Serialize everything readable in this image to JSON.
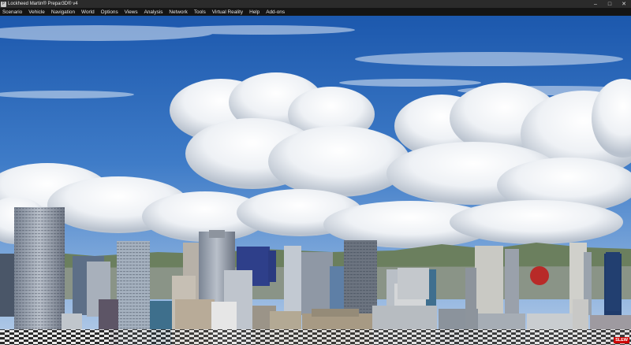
{
  "window": {
    "title": "Lockheed Martin® Prepar3D® v4",
    "app_icon": "p3d-app-icon",
    "controls": {
      "minimize": "–",
      "maximize": "□",
      "close": "✕"
    }
  },
  "menu": {
    "items": [
      {
        "label": "Scenario"
      },
      {
        "label": "Vehicle"
      },
      {
        "label": "Navigation"
      },
      {
        "label": "World"
      },
      {
        "label": "Options"
      },
      {
        "label": "Views"
      },
      {
        "label": "Analysis"
      },
      {
        "label": "Network"
      },
      {
        "label": "Tools"
      },
      {
        "label": "Virtual Reality"
      },
      {
        "label": "Help"
      },
      {
        "label": "Add-ons"
      }
    ]
  },
  "status": {
    "slew_label": "SLEW"
  },
  "colors": {
    "sky_top": "#1f5fb3",
    "sky_horizon": "#a9c6e6",
    "slew_badge": "#cc0000"
  }
}
